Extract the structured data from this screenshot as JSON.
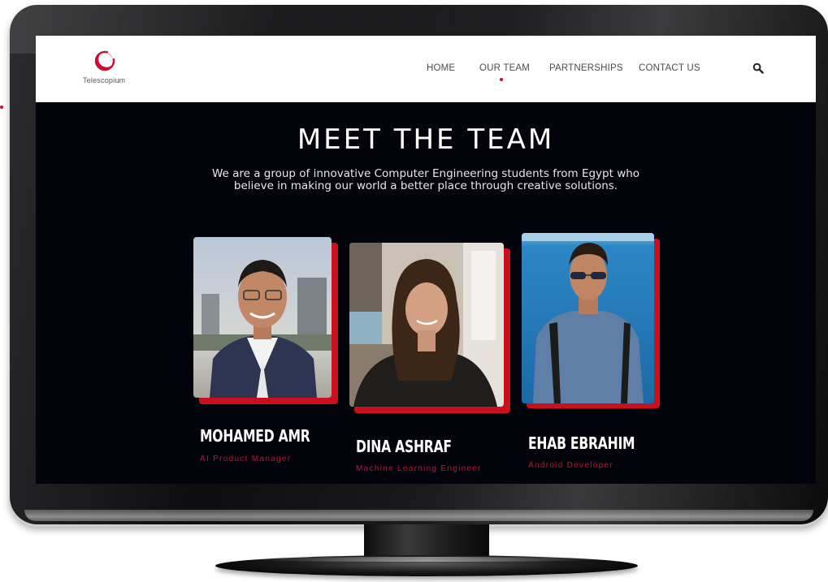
{
  "brand": {
    "name": "Telescopium",
    "accent": "#c8102e",
    "screen_bg": "#02030b"
  },
  "nav": {
    "items": [
      {
        "label": "HOME",
        "active": false
      },
      {
        "label": "OUR TEAM",
        "active": true
      },
      {
        "label": "PARTNERSHIPS",
        "active": false
      },
      {
        "label": "CONTACT US",
        "active": false
      }
    ],
    "search_icon": "search-icon"
  },
  "hero": {
    "title": "MEET THE TEAM",
    "subtitle_line1": "We are a group of innovative Computer Engineering students from Egypt who",
    "subtitle_line2": "believe in making our world a better place through creative solutions."
  },
  "team": [
    {
      "name": "MOHAMED AMR",
      "role": "AI Product Manager"
    },
    {
      "name": "DINA ASHRAF",
      "role": "Machine Learning Engineer"
    },
    {
      "name": "EHAB EBRAHIM",
      "role": "Android Developer"
    }
  ]
}
